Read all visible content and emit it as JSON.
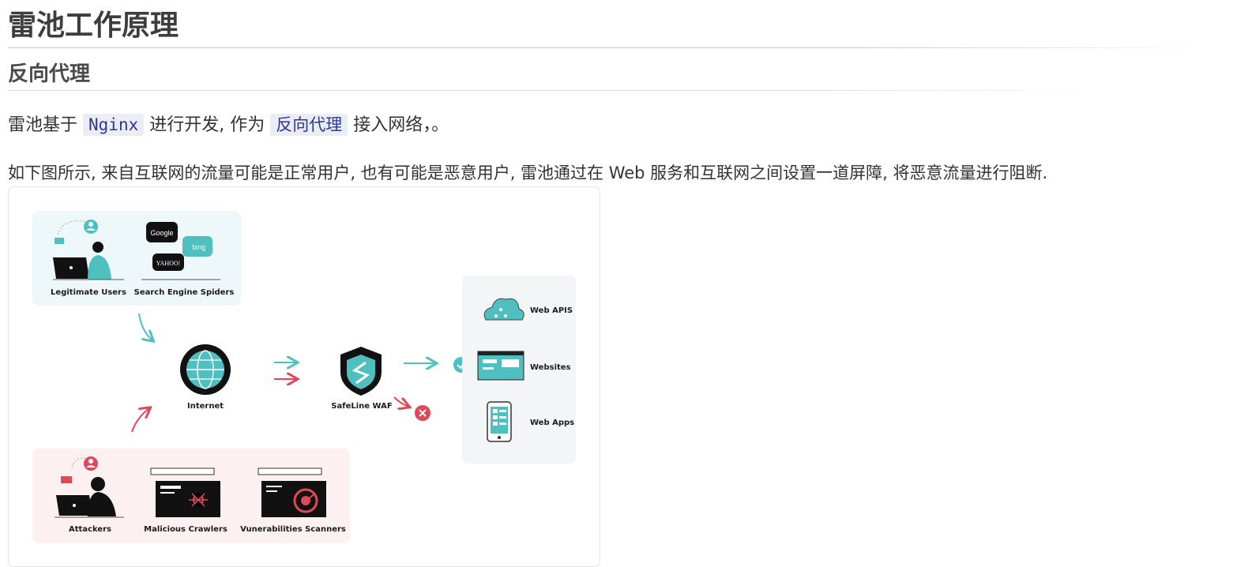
{
  "heading": "雷池工作原理",
  "subheading": "反向代理",
  "para1": {
    "prefix": "雷池基于",
    "code1": "Nginx",
    "middle": "进行开发, 作为",
    "code2": "反向代理",
    "suffix": "接入网络，。"
  },
  "para2": "如下图所示, 来自互联网的流量可能是正常用户, 也有可能是恶意用户, 雷池通过在 Web 服务和互联网之间设置一道屏障, 将恶意流量进行阻断.",
  "diagram": {
    "good_sources": [
      "Legitimate Users",
      "Search Engine Spiders"
    ],
    "search_engines": [
      "Google",
      "bing",
      "YAHOO!"
    ],
    "bad_sources": [
      "Attackers",
      "Malicious Crawlers",
      "Vunerabilities Scanners"
    ],
    "internet": "Internet",
    "waf": "SafeLine WAF",
    "targets": [
      "Web APIS",
      "Websites",
      "Web Apps"
    ],
    "colors": {
      "teal": "#4fbfbf",
      "red": "#e0485a",
      "good_panel": "#eef8fb",
      "bad_panel": "#fcf0f1",
      "target_panel": "#f4f5f7"
    }
  }
}
